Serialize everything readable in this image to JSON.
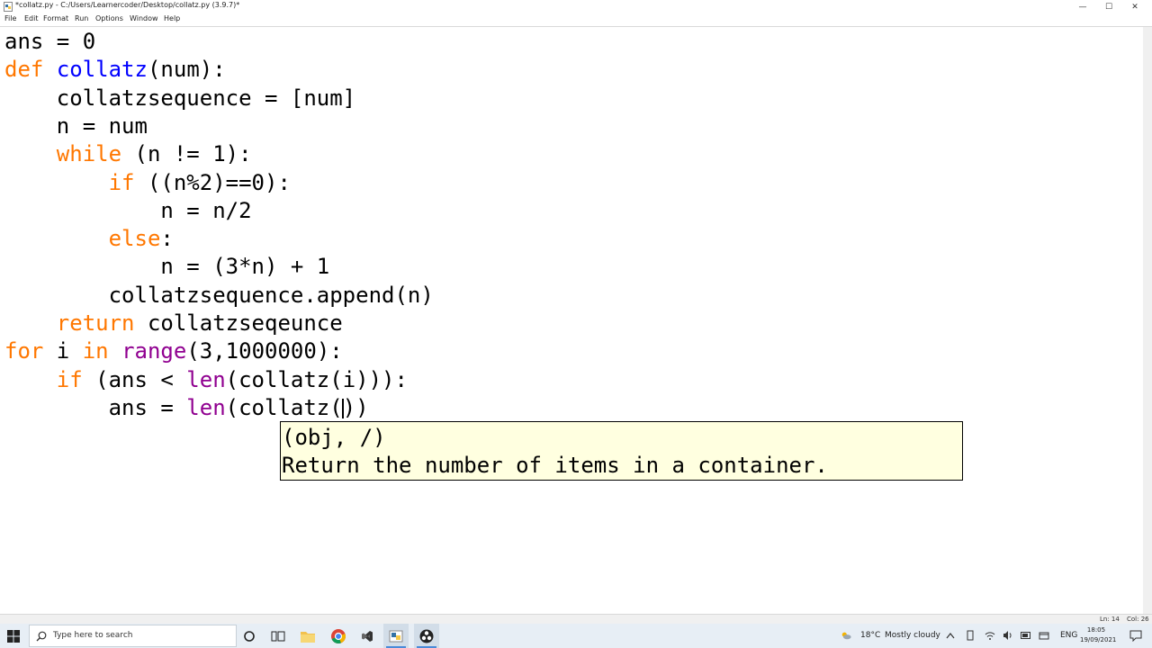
{
  "window": {
    "title": "*collatz.py - C:/Users/Learnercoder/Desktop/collatz.py (3.9.7)*",
    "controls": [
      "—",
      "☐",
      "✕"
    ]
  },
  "menu": [
    "File",
    "Edit",
    "Format",
    "Run",
    "Options",
    "Window",
    "Help"
  ],
  "editor": {
    "lines": [
      "ans = 0",
      "def collatz(num):",
      "    collatzsequence = [num]",
      "    n = num",
      "    while (n != 1):",
      "        if ((n%2)==0):",
      "            n = n/2",
      "        else:",
      "            n = (3*n) + 1",
      "        collatzsequence.append(n)",
      "    return collatzseqeunce",
      "for i in range(3,1000000):",
      "    if (ans < len(collatz(i))):",
      "        ans = len(collatz())"
    ]
  },
  "calltip": {
    "signature": "(obj, /)",
    "doc": "Return the number of items in a container."
  },
  "status": {
    "line": "Ln: 14",
    "col": "Col: 26"
  },
  "taskbar": {
    "search_placeholder": "Type here to search",
    "weather_temp": "18°C",
    "weather_desc": "Mostly cloudy",
    "language": "ENG",
    "time": "18:05",
    "date": "19/09/2021"
  },
  "colors": {
    "keyword": "#ff7700",
    "builtin": "#900090",
    "definition": "#0000ff",
    "calltip_bg": "#ffffe0",
    "taskbar_bg": "#e7eef5"
  }
}
